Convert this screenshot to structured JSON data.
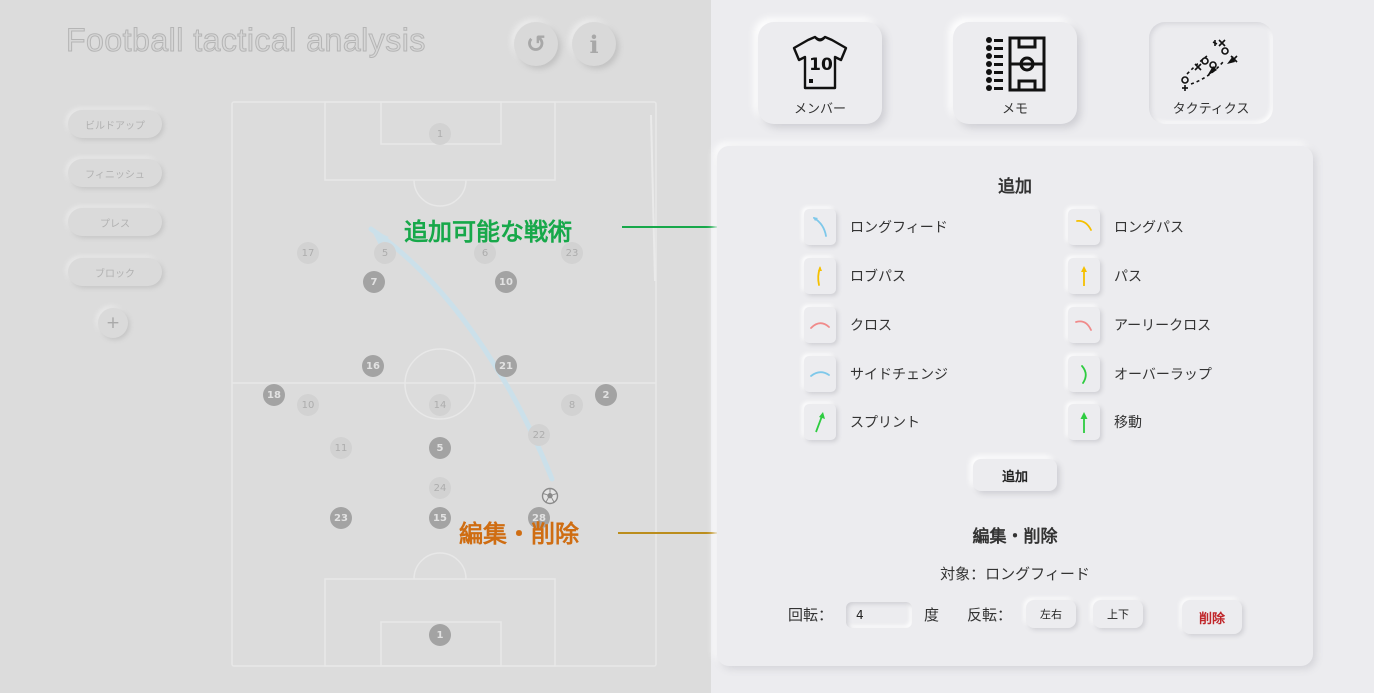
{
  "header": {
    "app_title": "Football tactical analysis",
    "undo_icon": "↺",
    "info_icon": "i"
  },
  "sidebar": {
    "tactics": [
      {
        "label": "ビルドアップ"
      },
      {
        "label": "フィニッシュ"
      },
      {
        "label": "プレス"
      },
      {
        "label": "ブロック"
      }
    ],
    "add_label": "+"
  },
  "pitch": {
    "home_players": [
      "1",
      "7",
      "10",
      "16",
      "21",
      "18",
      "2",
      "5",
      "23",
      "15",
      "28"
    ],
    "away_players": [
      "1",
      "17",
      "5",
      "6",
      "23",
      "10",
      "14",
      "8",
      "11",
      "22",
      "24"
    ]
  },
  "callouts": {
    "tactics": "追加可能な戦術",
    "edit": "編集・削除"
  },
  "top_buttons": {
    "members": {
      "label": "メンバー",
      "icon": "jersey-icon",
      "jersey_number": "10"
    },
    "memo": {
      "label": "メモ",
      "icon": "formation-memo-icon"
    },
    "tactics": {
      "label": "タクティクス",
      "icon": "tactics-board-icon"
    }
  },
  "panel": {
    "add_heading": "追加",
    "tactic_types": [
      {
        "label": "ロングフィード",
        "color": "#7ec8ea",
        "icon": "curved-arrow-icon"
      },
      {
        "label": "ロングパス",
        "color": "#f5c000",
        "icon": "curved-arrow-icon"
      },
      {
        "label": "ロブパス",
        "color": "#f5c000",
        "icon": "short-curve-icon"
      },
      {
        "label": "パス",
        "color": "#f5c000",
        "icon": "straight-arrow-icon"
      },
      {
        "label": "クロス",
        "color": "#f08a8a",
        "icon": "arc-icon"
      },
      {
        "label": "アーリークロス",
        "color": "#f08a8a",
        "icon": "arc-icon"
      },
      {
        "label": "サイドチェンジ",
        "color": "#7ec8ea",
        "icon": "arc-icon"
      },
      {
        "label": "オーバーラップ",
        "color": "#2ecc40",
        "icon": "short-curve-icon"
      },
      {
        "label": "スプリント",
        "color": "#2ecc40",
        "icon": "straight-arrow-icon"
      },
      {
        "label": "移動",
        "color": "#2ecc40",
        "icon": "straight-arrow-icon"
      }
    ],
    "add_button": "追加",
    "edit_heading": "編集・削除",
    "target_label": "対象：ロングフィード",
    "rotation_label": "回転：",
    "rotation_value": "4",
    "degree_label": "度",
    "flip_label": "反転：",
    "flip_lr": "左右",
    "flip_ud": "上下",
    "delete": "削除"
  },
  "colors": {
    "background": "#ececef",
    "overlay": "#dcdcdc",
    "callout_tactics": "#17a84a",
    "callout_edit": "#cf6d12",
    "delete_text": "#c0262a"
  }
}
